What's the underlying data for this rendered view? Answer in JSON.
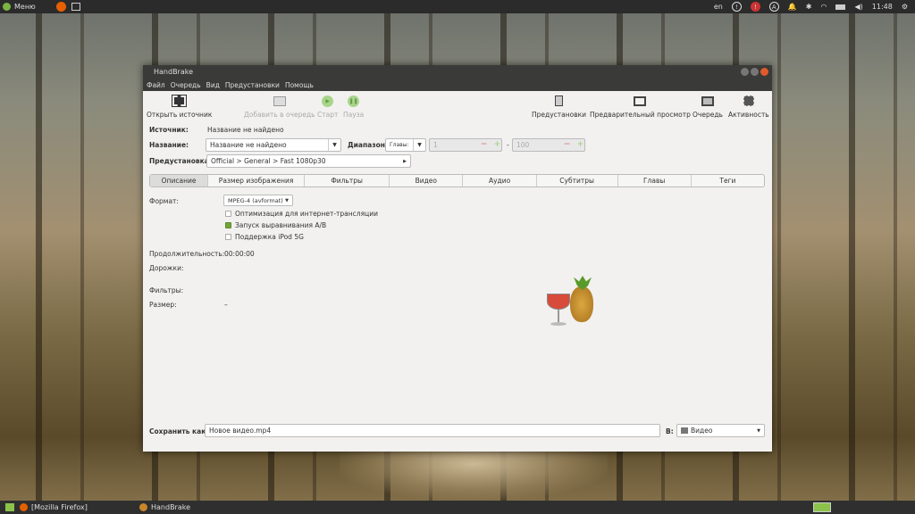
{
  "topbar": {
    "menu": "Меню",
    "lang": "en",
    "time": "11:48"
  },
  "taskbar": {
    "items": [
      "[Mozilla Firefox]",
      "HandBrake"
    ]
  },
  "window": {
    "title": "HandBrake",
    "menu": [
      "Файл",
      "Очередь",
      "Вид",
      "Предустановки",
      "Помощь"
    ],
    "toolbar": {
      "open": "Открыть источник",
      "add_queue": "Добавить в очередь",
      "start": "Старт",
      "pause": "Пауза",
      "presets": "Предустановки",
      "preview": "Предварительный просмотр",
      "queue": "Очередь",
      "activity": "Активность"
    },
    "source_label": "Источник:",
    "source_value": "Название не найдено",
    "title_label": "Название:",
    "title_value": "Название не найдено",
    "range_label": "Диапазон:",
    "range_mode": "Главы:",
    "range_start": "1",
    "range_end": "100",
    "range_dash": "-",
    "preset_label": "Предустановка:",
    "preset_value": "Official > General > Fast 1080p30",
    "tabs": [
      "Описание",
      "Размер изображения",
      "Фильтры",
      "Видео",
      "Аудио",
      "Субтитры",
      "Главы",
      "Теги"
    ],
    "format_label": "Формат:",
    "format_value": "MPEG-4 (avformat)",
    "checkboxes": [
      {
        "label": "Оптимизация для интернет-трансляции",
        "checked": false
      },
      {
        "label": "Запуск выравнивания A/B",
        "checked": true
      },
      {
        "label": "Поддержка iPod 5G",
        "checked": false
      }
    ],
    "duration_label": "Продолжительность:",
    "duration_value": "00:00:00",
    "tracks_label": "Дорожки:",
    "filters_label": "Фильтры:",
    "size_label": "Размер:",
    "size_value": "–",
    "save_label": "Сохранить как:",
    "save_value": "Новое видео.mp4",
    "dest_label": "В:",
    "dest_value": "Видео"
  }
}
